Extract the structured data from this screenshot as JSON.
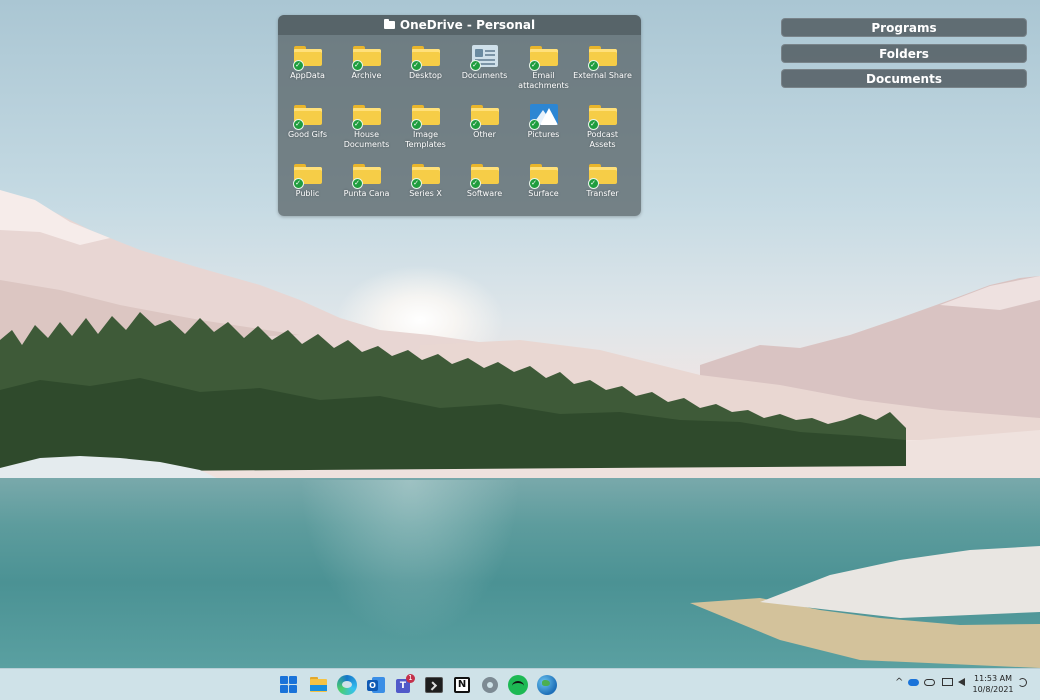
{
  "fence": {
    "title": "OneDrive - Personal",
    "items": [
      {
        "label": "AppData",
        "icon": "folder-icon"
      },
      {
        "label": "Archive",
        "icon": "folder-icon"
      },
      {
        "label": "Desktop",
        "icon": "folder-icon"
      },
      {
        "label": "Documents",
        "icon": "documents-icon"
      },
      {
        "label": "Email attachments",
        "icon": "folder-icon"
      },
      {
        "label": "External Share",
        "icon": "folder-icon"
      },
      {
        "label": "Good Gifs",
        "icon": "folder-icon"
      },
      {
        "label": "House Documents",
        "icon": "folder-icon"
      },
      {
        "label": "Image Templates",
        "icon": "folder-icon"
      },
      {
        "label": "Other",
        "icon": "folder-icon"
      },
      {
        "label": "Pictures",
        "icon": "pictures-icon"
      },
      {
        "label": "Podcast Assets",
        "icon": "folder-icon"
      },
      {
        "label": "Public",
        "icon": "folder-icon"
      },
      {
        "label": "Punta Cana",
        "icon": "folder-icon"
      },
      {
        "label": "Series X",
        "icon": "folder-icon"
      },
      {
        "label": "Software",
        "icon": "folder-icon"
      },
      {
        "label": "Surface",
        "icon": "folder-icon"
      },
      {
        "label": "Transfer",
        "icon": "folder-icon"
      }
    ]
  },
  "quick_buttons": {
    "programs": "Programs",
    "folders": "Folders",
    "documents": "Documents"
  },
  "taskbar": {
    "apps": [
      "start-icon",
      "file-explorer-icon",
      "edge-icon",
      "outlook-icon",
      "teams-icon",
      "terminal-icon",
      "notion-icon",
      "settings-icon",
      "spotify-icon",
      "globe-icon"
    ],
    "teams_badge": "1",
    "tray": {
      "chevron": "^",
      "onedrive_icon": "cloud-icon",
      "network_icon": "monitor-icon",
      "volume_icon": "speaker-icon"
    },
    "clock": {
      "time": "11:53 AM",
      "date": "10/8/2021"
    }
  },
  "colors": {
    "sync_check": "#1f9d3e",
    "folder": "#f6cd47",
    "fence_bg": "#5c686c",
    "taskbar": "#cfe2e8"
  }
}
